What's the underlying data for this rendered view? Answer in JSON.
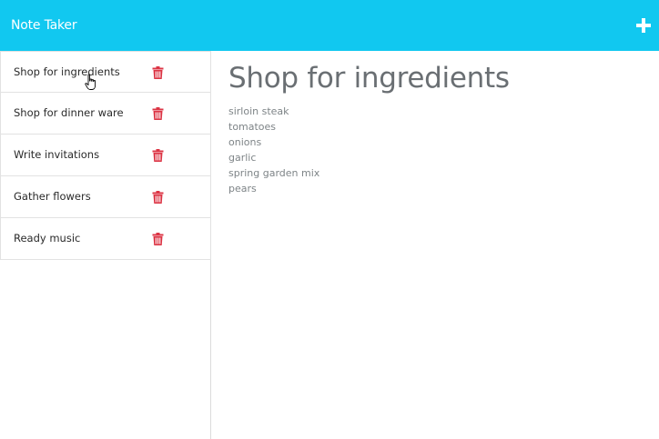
{
  "navbar": {
    "brand": "Note Taker",
    "add_icon": "plus-icon",
    "background": "#11c8f0"
  },
  "sidebar": {
    "notes": [
      {
        "title": "Shop for ingredients",
        "delete_icon": "trash-icon"
      },
      {
        "title": "Shop for dinner ware",
        "delete_icon": "trash-icon"
      },
      {
        "title": "Write invitations",
        "delete_icon": "trash-icon"
      },
      {
        "title": "Gather flowers",
        "delete_icon": "trash-icon"
      },
      {
        "title": "Ready music",
        "delete_icon": "trash-icon"
      }
    ],
    "delete_color": "#dc3545"
  },
  "main": {
    "title": "Shop for ingredients",
    "body_lines": [
      "sirloin steak",
      "tomatoes",
      "onions",
      "garlic",
      "spring garden mix",
      "pears"
    ]
  }
}
